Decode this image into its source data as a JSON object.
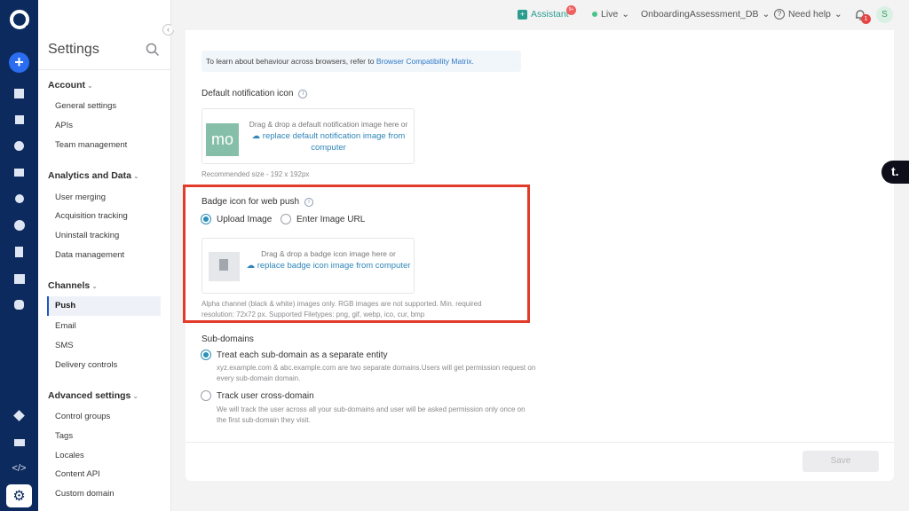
{
  "sidebar": {
    "title": "Settings",
    "sections": [
      {
        "label": "Account",
        "items": [
          "General settings",
          "APIs",
          "Team management"
        ]
      },
      {
        "label": "Analytics and Data",
        "items": [
          "User merging",
          "Acquisition tracking",
          "Uninstall tracking",
          "Data management"
        ]
      },
      {
        "label": "Channels",
        "items": [
          "Push",
          "Email",
          "SMS",
          "Delivery controls"
        ]
      },
      {
        "label": "Advanced settings",
        "items": [
          "Control groups",
          "Tags",
          "Locales",
          "Content API",
          "Custom domain"
        ]
      }
    ],
    "active_item": "Push"
  },
  "topbar": {
    "assistant_label": "Assistant",
    "assistant_badge": "9+",
    "env_label": "Live",
    "workspace_label": "OnboardingAssessment_DB",
    "help_label": "Need help",
    "notification_count": "1",
    "user_initial": "S"
  },
  "notice": {
    "text": "To learn about behaviour across browsers, refer to ",
    "link": "Browser Compatibility Matrix."
  },
  "default_icon": {
    "label": "Default notification icon",
    "thumb_text": "mo",
    "drag_text": "Drag & drop a default notification image here or",
    "link_text": "replace default notification image from computer",
    "hint": "Recommended size - 192 x 192px"
  },
  "badge_icon": {
    "label": "Badge icon for web push",
    "option_upload": "Upload Image",
    "option_url": "Enter Image URL",
    "selected": "Upload Image",
    "drag_text": "Drag & drop a badge icon image here or",
    "link_text": "replace badge icon image from computer",
    "hint": "Alpha channel (black & white) images only. RGB images are not supported. Min. required resolution: 72x72 px. Supported Filetypes: png, gif, webp, ico, cur, bmp"
  },
  "subdomains": {
    "label": "Sub-domains",
    "option1": "Treat each sub-domain as a separate entity",
    "option1_desc": "xyz.example.com & abc.example.com are two separate domains.Users will get permission request on every sub-domain domain.",
    "option2": "Track user cross-domain",
    "option2_desc": "We will track the user across all your sub-domains and user will be asked permission only once on the first sub-domain they visit.",
    "selected": "option1"
  },
  "save_label": "Save",
  "chat_widget_label": "t."
}
